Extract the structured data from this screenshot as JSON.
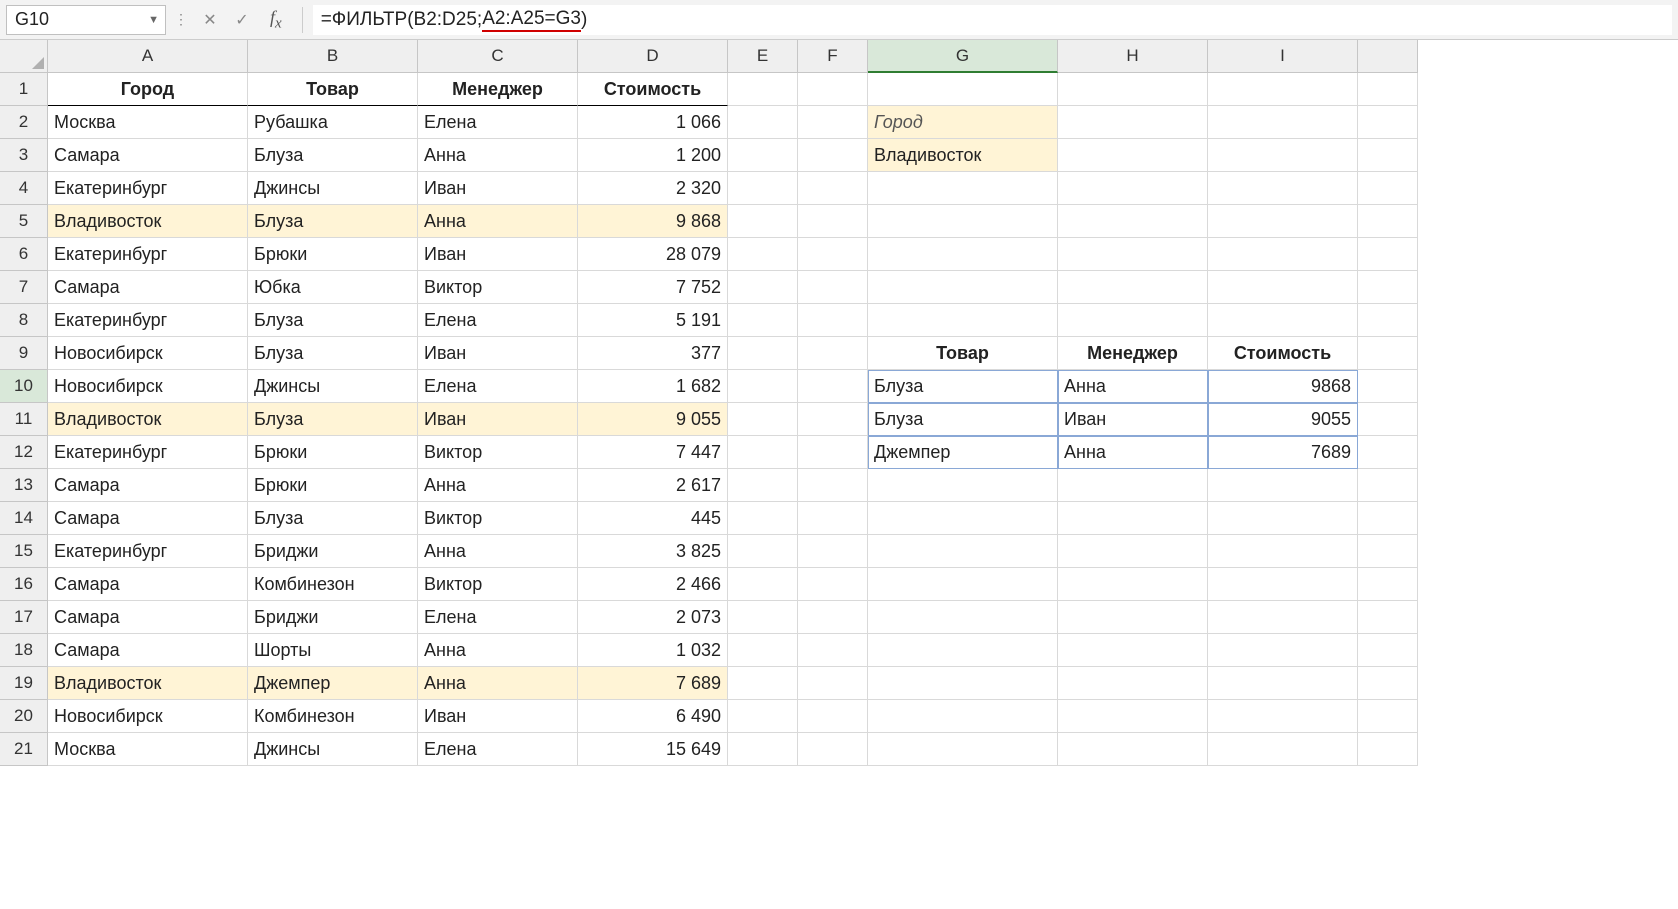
{
  "nameBox": "G10",
  "formula_prefix": "=ФИЛЬТР(B2:D25;",
  "formula_mid": "A2:A25=G3",
  "formula_suffix": ")",
  "columns": [
    "A",
    "B",
    "C",
    "D",
    "E",
    "F",
    "G",
    "H",
    "I"
  ],
  "activeColIndex": 6,
  "rowCount": 21,
  "activeRow": 10,
  "tableHeaders": {
    "city": "Город",
    "product": "Товар",
    "manager": "Менеджер",
    "cost": "Стоимость"
  },
  "mainData": [
    {
      "city": "Москва",
      "product": "Рубашка",
      "manager": "Елена",
      "cost": "1 066",
      "hl": false
    },
    {
      "city": "Самара",
      "product": "Блуза",
      "manager": "Анна",
      "cost": "1 200",
      "hl": false
    },
    {
      "city": "Екатеринбург",
      "product": "Джинсы",
      "manager": "Иван",
      "cost": "2 320",
      "hl": false
    },
    {
      "city": "Владивосток",
      "product": "Блуза",
      "manager": "Анна",
      "cost": "9 868",
      "hl": true
    },
    {
      "city": "Екатеринбург",
      "product": "Брюки",
      "manager": "Иван",
      "cost": "28 079",
      "hl": false
    },
    {
      "city": "Самара",
      "product": "Юбка",
      "manager": "Виктор",
      "cost": "7 752",
      "hl": false
    },
    {
      "city": "Екатеринбург",
      "product": "Блуза",
      "manager": "Елена",
      "cost": "5 191",
      "hl": false
    },
    {
      "city": "Новосибирск",
      "product": "Блуза",
      "manager": "Иван",
      "cost": "377",
      "hl": false
    },
    {
      "city": "Новосибирск",
      "product": "Джинсы",
      "manager": "Елена",
      "cost": "1 682",
      "hl": false
    },
    {
      "city": "Владивосток",
      "product": "Блуза",
      "manager": "Иван",
      "cost": "9 055",
      "hl": true
    },
    {
      "city": "Екатеринбург",
      "product": "Брюки",
      "manager": "Виктор",
      "cost": "7 447",
      "hl": false
    },
    {
      "city": "Самара",
      "product": "Брюки",
      "manager": "Анна",
      "cost": "2 617",
      "hl": false
    },
    {
      "city": "Самара",
      "product": "Блуза",
      "manager": "Виктор",
      "cost": "445",
      "hl": false
    },
    {
      "city": "Екатеринбург",
      "product": "Бриджи",
      "manager": "Анна",
      "cost": "3 825",
      "hl": false
    },
    {
      "city": "Самара",
      "product": "Комбинезон",
      "manager": "Виктор",
      "cost": "2 466",
      "hl": false
    },
    {
      "city": "Самара",
      "product": "Бриджи",
      "manager": "Елена",
      "cost": "2 073",
      "hl": false
    },
    {
      "city": "Самара",
      "product": "Шорты",
      "manager": "Анна",
      "cost": "1 032",
      "hl": false
    },
    {
      "city": "Владивосток",
      "product": "Джемпер",
      "manager": "Анна",
      "cost": "7 689",
      "hl": true
    },
    {
      "city": "Новосибирск",
      "product": "Комбинезон",
      "manager": "Иван",
      "cost": "6 490",
      "hl": false
    },
    {
      "city": "Москва",
      "product": "Джинсы",
      "manager": "Елена",
      "cost": "15 649",
      "hl": false
    }
  ],
  "filterLabel": "Город",
  "filterValue": "Владивосток",
  "resultHeaders": {
    "product": "Товар",
    "manager": "Менеджер",
    "cost": "Стоимость"
  },
  "resultData": [
    {
      "product": "Блуза",
      "manager": "Анна",
      "cost": "9868"
    },
    {
      "product": "Блуза",
      "manager": "Иван",
      "cost": "9055"
    },
    {
      "product": "Джемпер",
      "manager": "Анна",
      "cost": "7689"
    }
  ]
}
